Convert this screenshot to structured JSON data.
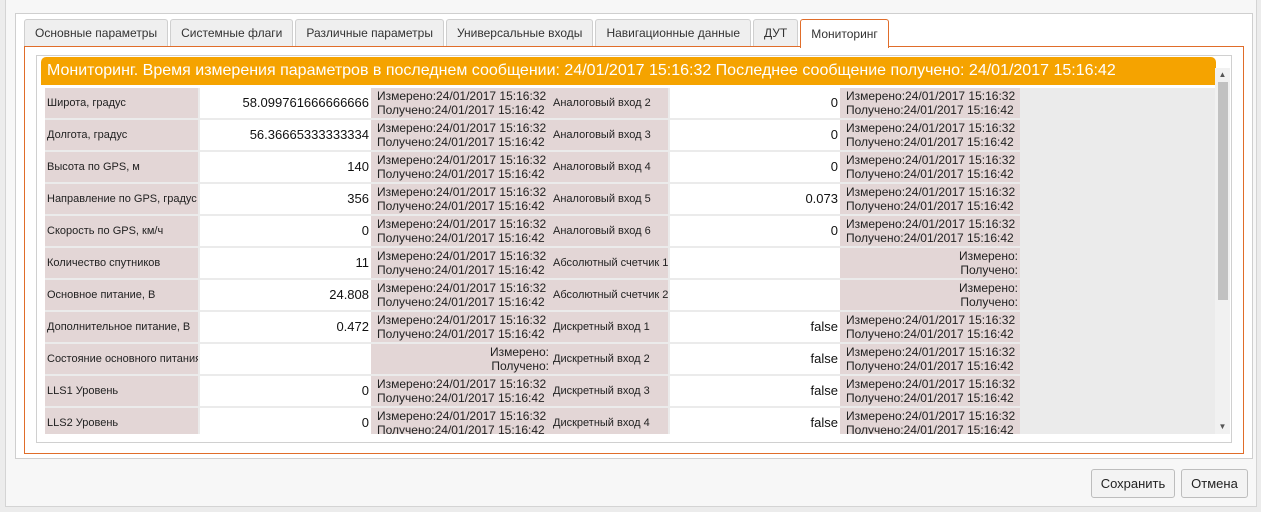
{
  "tabs": [
    {
      "label": "Основные параметры"
    },
    {
      "label": "Системные флаги"
    },
    {
      "label": "Различные параметры"
    },
    {
      "label": "Универсальные входы"
    },
    {
      "label": "Навигационные данные"
    },
    {
      "label": "ДУТ"
    },
    {
      "label": "Мониторинг"
    }
  ],
  "active_tab": "Мониторинг",
  "banner": "Мониторинг. Время измерения параметров в последнем сообщении: 24/01/2017 15:16:32 Последнее сообщение получено: 24/01/2017 15:16:42",
  "rows": [
    {
      "left": {
        "label": "Широта, градус",
        "value": "58.099761666666666",
        "measured": "Измерено:24/01/2017 15:16:32",
        "received": "Получено:24/01/2017 15:16:42"
      },
      "right": {
        "label": "Аналоговый вход 2",
        "value": "0",
        "measured": "Измерено:24/01/2017 15:16:32",
        "received": "Получено:24/01/2017 15:16:42"
      }
    },
    {
      "left": {
        "label": "Долгота, градус",
        "value": "56.36665333333334",
        "measured": "Измерено:24/01/2017 15:16:32",
        "received": "Получено:24/01/2017 15:16:42"
      },
      "right": {
        "label": "Аналоговый вход 3",
        "value": "0",
        "measured": "Измерено:24/01/2017 15:16:32",
        "received": "Получено:24/01/2017 15:16:42"
      }
    },
    {
      "left": {
        "label": "Высота по GPS, м",
        "value": "140",
        "measured": "Измерено:24/01/2017 15:16:32",
        "received": "Получено:24/01/2017 15:16:42"
      },
      "right": {
        "label": "Аналоговый вход 4",
        "value": "0",
        "measured": "Измерено:24/01/2017 15:16:32",
        "received": "Получено:24/01/2017 15:16:42"
      }
    },
    {
      "left": {
        "label": "Направление по GPS, градус",
        "value": "356",
        "measured": "Измерено:24/01/2017 15:16:32",
        "received": "Получено:24/01/2017 15:16:42"
      },
      "right": {
        "label": "Аналоговый вход 5",
        "value": "0.073",
        "measured": "Измерено:24/01/2017 15:16:32",
        "received": "Получено:24/01/2017 15:16:42"
      }
    },
    {
      "left": {
        "label": "Скорость по GPS, км/ч",
        "value": "0",
        "measured": "Измерено:24/01/2017 15:16:32",
        "received": "Получено:24/01/2017 15:16:42"
      },
      "right": {
        "label": "Аналоговый вход 6",
        "value": "0",
        "measured": "Измерено:24/01/2017 15:16:32",
        "received": "Получено:24/01/2017 15:16:42"
      }
    },
    {
      "left": {
        "label": "Количество спутников",
        "value": "11",
        "measured": "Измерено:24/01/2017 15:16:32",
        "received": "Получено:24/01/2017 15:16:42"
      },
      "right": {
        "label": "Абсолютный счетчик 1",
        "value": "",
        "measured": "Измерено:",
        "received": "Получено:"
      }
    },
    {
      "left": {
        "label": "Основное питание, В",
        "value": "24.808",
        "measured": "Измерено:24/01/2017 15:16:32",
        "received": "Получено:24/01/2017 15:16:42"
      },
      "right": {
        "label": "Абсолютный счетчик 2",
        "value": "",
        "measured": "Измерено:",
        "received": "Получено:"
      }
    },
    {
      "left": {
        "label": "Дополнительное питание, В",
        "value": "0.472",
        "measured": "Измерено:24/01/2017 15:16:32",
        "received": "Получено:24/01/2017 15:16:42"
      },
      "right": {
        "label": "Дискретный вход 1",
        "value": "false",
        "measured": "Измерено:24/01/2017 15:16:32",
        "received": "Получено:24/01/2017 15:16:42"
      }
    },
    {
      "left": {
        "label": "Состояние основного питания",
        "value": "",
        "measured": "Измерено:",
        "received": "Получено:"
      },
      "right": {
        "label": "Дискретный вход 2",
        "value": "false",
        "measured": "Измерено:24/01/2017 15:16:32",
        "received": "Получено:24/01/2017 15:16:42"
      }
    },
    {
      "left": {
        "label": "LLS1 Уровень",
        "value": "0",
        "measured": "Измерено:24/01/2017 15:16:32",
        "received": "Получено:24/01/2017 15:16:42"
      },
      "right": {
        "label": "Дискретный вход 3",
        "value": "false",
        "measured": "Измерено:24/01/2017 15:16:32",
        "received": "Получено:24/01/2017 15:16:42"
      }
    },
    {
      "left": {
        "label": "LLS2 Уровень",
        "value": "0",
        "measured": "Измерено:24/01/2017 15:16:32",
        "received": "Получено:24/01/2017 15:16:42"
      },
      "right": {
        "label": "Дискретный вход 4",
        "value": "false",
        "measured": "Измерено:24/01/2017 15:16:32",
        "received": "Получено:24/01/2017 15:16:42"
      }
    }
  ],
  "buttons": {
    "save": "Сохранить",
    "cancel": "Отмена"
  },
  "scrollbar": {
    "up_icon": "scroll-up-arrow-icon",
    "down_icon": "scroll-down-arrow-icon"
  },
  "colors": {
    "accent": "#f5a300",
    "active_tab_border": "#e06d2a",
    "label_bg": "#e3d6d6"
  }
}
